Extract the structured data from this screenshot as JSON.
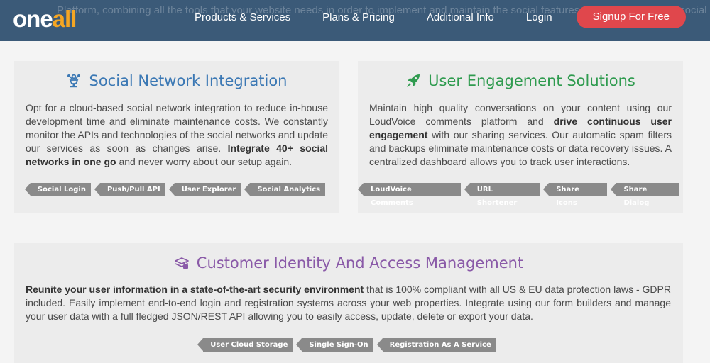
{
  "header": {
    "logo_one": "one",
    "logo_all": "all",
    "ghost_text": "Platform, combining all the tools that your website needs in order to implement and maintain the social features and integrating their social network into your web properties. Do not hesitate to contact us.",
    "nav": [
      {
        "label": "Products & Services"
      },
      {
        "label": "Plans & Pricing"
      },
      {
        "label": "Additional Info"
      },
      {
        "label": "Login"
      }
    ],
    "signup_label": "Signup For Free"
  },
  "social": {
    "title": "Social Network Integration",
    "body_plain": "Opt for a cloud-based social network integration to reduce in-house development time and eliminate maintenance costs. We constantly monitor the APIs and technologies of the social networks and update our services as soon as changes arise. ",
    "body_bold": "Integrate 40+ social networks in one go",
    "body_tail": " and never worry about our setup again.",
    "tags": [
      "Social Login",
      "Push/Pull API",
      "User Explorer",
      "Social Analytics"
    ]
  },
  "engage": {
    "title": "User Engagement Solutions",
    "body_plain": "Maintain high quality conversations on your content using our LoudVoice comments platform and ",
    "body_bold": "drive continuous user engagement",
    "body_tail": " with our sharing services. Our automatic spam filters and backups eliminate maintenance costs or data recovery issues. A centralized dashboard allows you to track user interactions.",
    "tags": [
      "LoudVoice Comments",
      "URL Shortener",
      "Share Icons",
      "Share Dialog"
    ]
  },
  "ciam": {
    "title": "Customer Identity And Access Management",
    "body_bold": "Reunite your user information in a state-of-the-art security environment",
    "body_tail": " that is 100% compliant with all US & EU data protection laws - GDPR included. Easily implement end-to-end login and registration systems across your web properties. Integrate using our form builders and manage your user data with a full fledged JSON/REST API allowing you to easily access, update, delete or export your data.",
    "tags": [
      "User Cloud Storage",
      "Single Sign-On",
      "Registration As A Service"
    ]
  },
  "colors": {
    "header_bg": "#3b5a78",
    "signup_bg": "#e0474c",
    "social_title": "#3b78b4",
    "engage_title": "#2f9b4f",
    "ciam_title": "#8a5aa8",
    "tag_bg": "#8a8a8a"
  },
  "icons": {
    "social": "network-trophy-icon",
    "engage": "rocket-icon",
    "ciam": "identity-card-icon"
  }
}
